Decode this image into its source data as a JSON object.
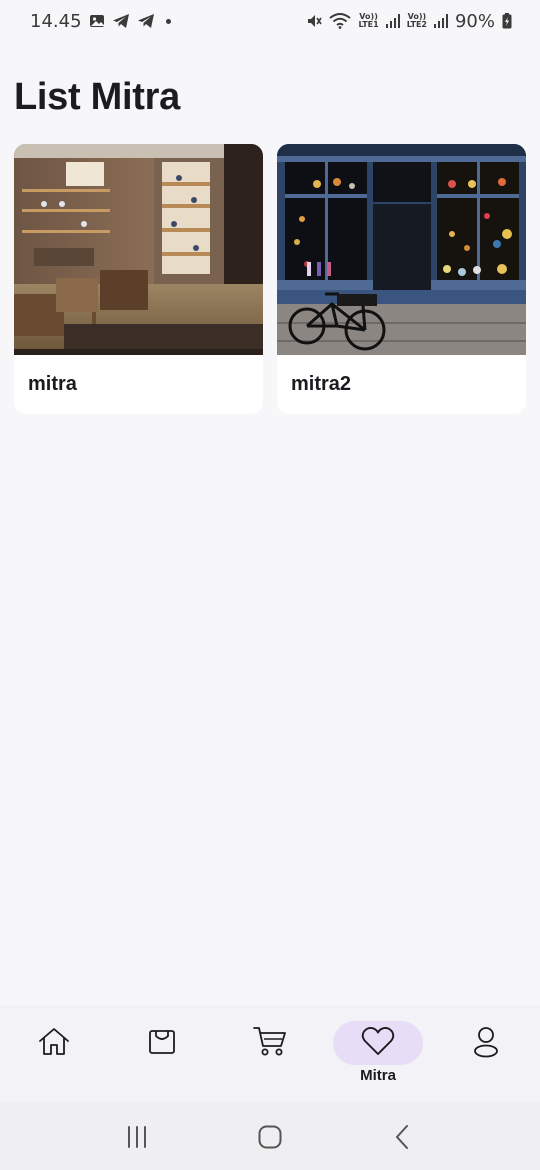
{
  "status_bar": {
    "time": "14.45",
    "battery": "90%",
    "lte1": "LTE1",
    "lte2": "LTE2",
    "volte": "Vo))"
  },
  "page": {
    "title": "List Mitra"
  },
  "partners": [
    {
      "name": "mitra"
    },
    {
      "name": "mitra2"
    }
  ],
  "bottom_nav": {
    "items": [
      {
        "icon": "home-icon",
        "label": ""
      },
      {
        "icon": "shopping-bag-icon",
        "label": ""
      },
      {
        "icon": "cart-icon",
        "label": ""
      },
      {
        "icon": "heart-icon",
        "label": "Mitra"
      },
      {
        "icon": "profile-icon",
        "label": ""
      }
    ],
    "active_index": 3
  },
  "colors": {
    "background": "#f7f7f9",
    "active_pill": "#e8ddf7",
    "text": "#1c1b1f"
  }
}
